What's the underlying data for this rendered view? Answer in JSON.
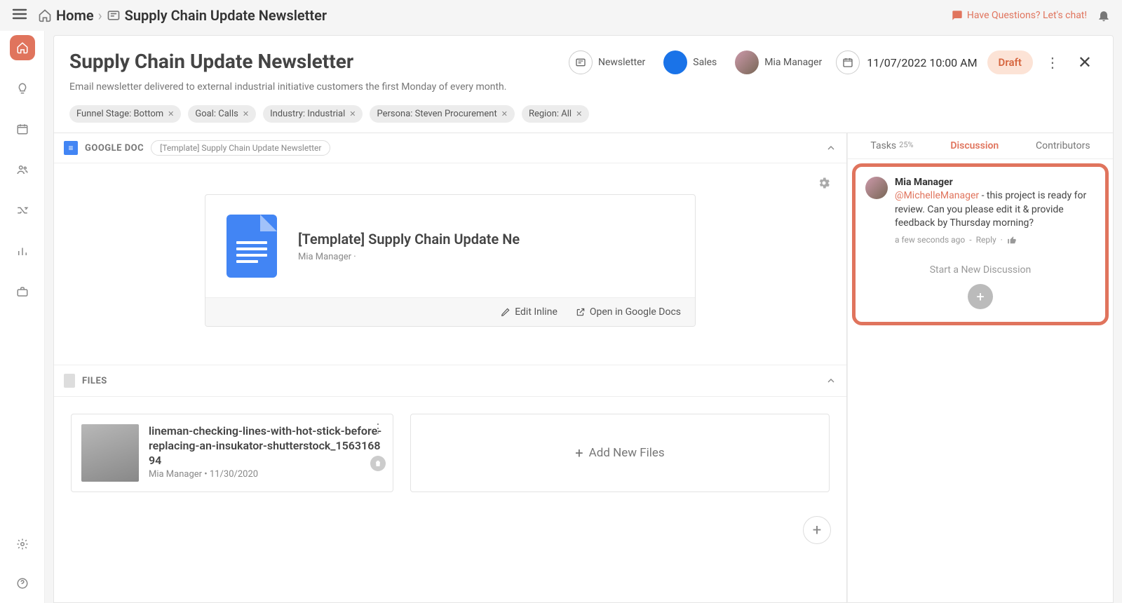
{
  "breadcrumb": {
    "home": "Home",
    "page": "Supply Chain Update Newsletter"
  },
  "have_questions": "Have Questions? Let's chat!",
  "header": {
    "title": "Supply Chain Update Newsletter",
    "desc": "Email newsletter delivered to external industrial initiative customers the first Monday of every month.",
    "newsletter_label": "Newsletter",
    "sales_label": "Sales",
    "owner": "Mia Manager",
    "datetime": "11/07/2022 10:00 AM",
    "status": "Draft"
  },
  "tags": [
    "Funnel Stage: Bottom",
    "Goal: Calls",
    "Industry: Industrial",
    "Persona: Steven Procurement",
    "Region: All"
  ],
  "gdoc": {
    "section_label": "GOOGLE DOC",
    "pill": "[Template] Supply Chain Update Newsletter",
    "title": "[Template] Supply Chain Update Ne",
    "author": "Mia Manager ·",
    "edit_inline": "Edit Inline",
    "open": "Open in Google Docs"
  },
  "files": {
    "section_label": "FILES",
    "item": {
      "name": "lineman-checking-lines-with-hot-stick-before-replacing-an-insukator-shutterstock_156316894",
      "meta": "Mia Manager • 11/30/2020"
    },
    "add": "Add New Files"
  },
  "tabs": {
    "tasks": "Tasks",
    "tasks_pct": "25%",
    "discussion": "Discussion",
    "contributors": "Contributors"
  },
  "discussion": {
    "name": "Mia Manager",
    "mention": "@MichelleManager",
    "text": " - this project is ready for review. Can you please edit it & provide feedback by Thursday morning?",
    "time": "a few seconds ago",
    "sep": "-",
    "reply": "Reply",
    "start_new": "Start a New Discussion"
  }
}
